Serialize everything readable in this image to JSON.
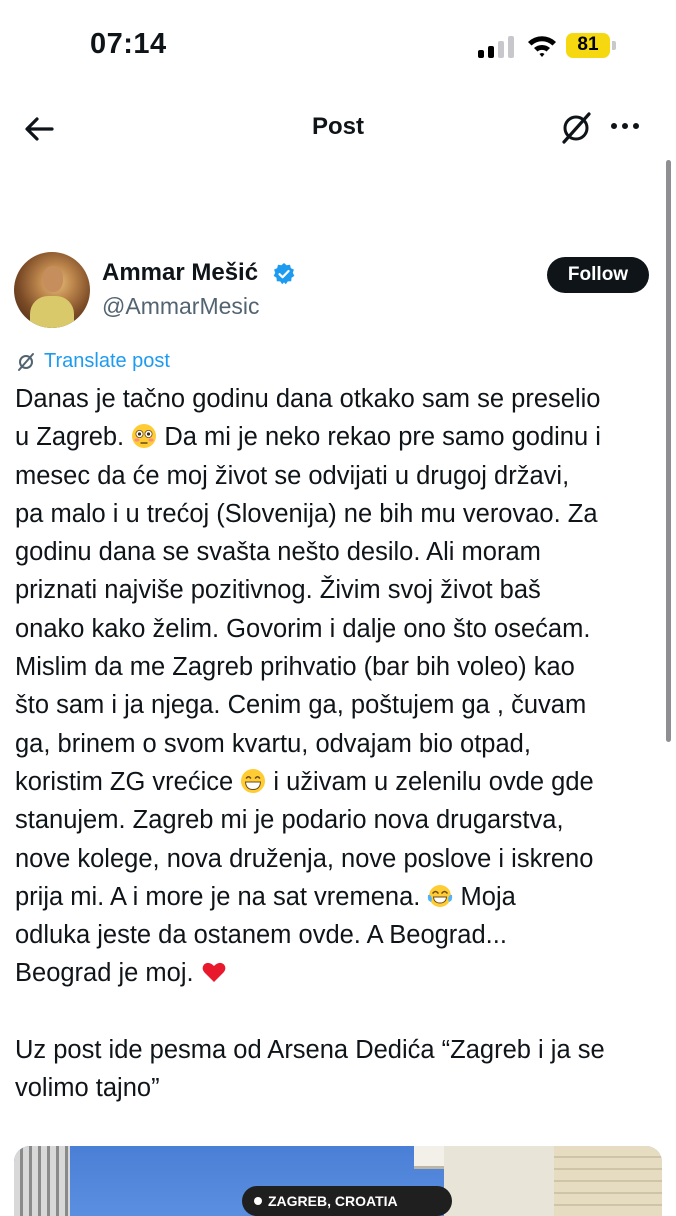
{
  "status_bar": {
    "time": "07:14",
    "battery": "81"
  },
  "nav": {
    "title": "Post"
  },
  "author": {
    "name": "Ammar Mešić",
    "handle": "@AmmarMesic",
    "follow_label": "Follow"
  },
  "translate_label": "Translate post",
  "post": {
    "lines": [
      "Danas je tačno godinu dana otkako sam se preselio",
      "u Zagreb.",
      "Da mi je neko rekao pre samo godinu i",
      "mesec da će moj život se odvijati u drugoj državi,",
      "pa malo i u trećoj (Slovenija) ne bih mu verovao. Za",
      "godinu dana se svašta nešto desilo. Ali moram",
      "priznati najviše pozitivnog. Živim svoj život baš",
      "onako kako želim. Govorim i dalje ono što osećam.",
      "Mislim da me Zagreb prihvatio (bar bih voleo) kao",
      "što sam i ja njega. Cenim ga, poštujem ga , čuvam",
      "ga, brinem o svom kvartu, odvajam bio otpad,",
      "koristim ZG vrećice",
      "i uživam u zelenilu ovde gde",
      "stanujem. Zagreb mi je podario nova drugarstva,",
      "nove kolege, nova druženja, nove poslove i iskreno",
      "prija mi. A i more je na sat vremena.",
      "Moja",
      "odluka jeste da ostanem ovde. A Beograd...",
      "Beograd je moj.",
      "Uz post ide pesma od Arsena Dedića “Zagreb i ja se",
      "volimo tajno”"
    ],
    "emojis": [
      "flushed-face",
      "grinning-face",
      "tears-of-joy-face",
      "red-heart"
    ]
  },
  "media": {
    "location": "ZAGREB, CROATIA"
  },
  "colors": {
    "link": "#1d9bf0",
    "battery": "#f5d80f",
    "text": "#0f1419",
    "muted": "#536471"
  }
}
